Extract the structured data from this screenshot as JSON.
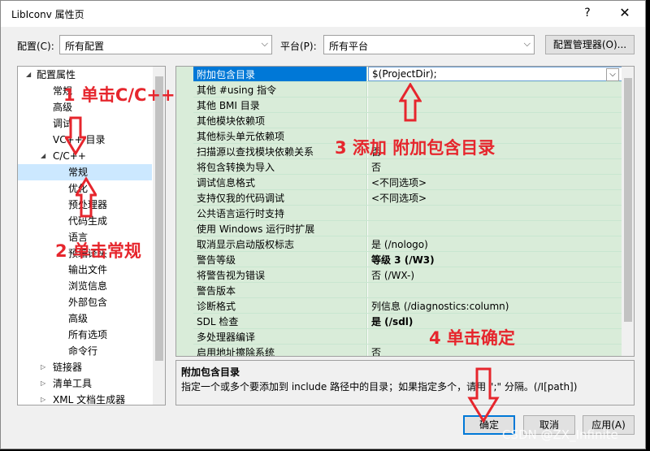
{
  "window": {
    "title": "LibIconv 属性页",
    "help": "?",
    "close": "✕"
  },
  "config": {
    "label": "配置(C):",
    "value": "所有配置"
  },
  "platform": {
    "label": "平台(P):",
    "value": "所有平台"
  },
  "config_manager": "配置管理器(O)...",
  "tree": {
    "items": [
      {
        "label": "配置属性",
        "expander": "◢"
      },
      {
        "label": "常规"
      },
      {
        "label": "高级"
      },
      {
        "label": "调试"
      },
      {
        "label": "VC++ 目录"
      },
      {
        "label": "C/C++",
        "expander": "◢"
      },
      {
        "label": "常规"
      },
      {
        "label": "优化"
      },
      {
        "label": "预处理器"
      },
      {
        "label": "代码生成"
      },
      {
        "label": "语言"
      },
      {
        "label": "预编译头"
      },
      {
        "label": "输出文件"
      },
      {
        "label": "浏览信息"
      },
      {
        "label": "外部包含"
      },
      {
        "label": "高级"
      },
      {
        "label": "所有选项"
      },
      {
        "label": "命令行"
      },
      {
        "label": "链接器",
        "expander": "▷"
      },
      {
        "label": "清单工具",
        "expander": "▷"
      },
      {
        "label": "XML 文档生成器",
        "expander": "▷"
      }
    ]
  },
  "grid": {
    "rows": [
      {
        "key": "附加包含目录",
        "value": "$(ProjectDir);"
      },
      {
        "key": "其他 #using 指令",
        "value": ""
      },
      {
        "key": "其他 BMI 目录",
        "value": ""
      },
      {
        "key": "其他模块依赖项",
        "value": ""
      },
      {
        "key": "其他标头单元依赖项",
        "value": ""
      },
      {
        "key": "扫描源以查找模块依赖关系",
        "value": "否"
      },
      {
        "key": "将包含转换为导入",
        "value": "否"
      },
      {
        "key": "调试信息格式",
        "value": "<不同选项>"
      },
      {
        "key": "支持仅我的代码调试",
        "value": "<不同选项>"
      },
      {
        "key": "公共语言运行时支持",
        "value": ""
      },
      {
        "key": "使用 Windows 运行时扩展",
        "value": ""
      },
      {
        "key": "取消显示启动版权标志",
        "value": "是 (/nologo)"
      },
      {
        "key": "警告等级",
        "value": "等级 3 (/W3)"
      },
      {
        "key": "将警告视为错误",
        "value": "否 (/WX-)"
      },
      {
        "key": "警告版本",
        "value": ""
      },
      {
        "key": "诊断格式",
        "value": "列信息 (/diagnostics:column)"
      },
      {
        "key": "SDL 检查",
        "value": "是 (/sdl)"
      },
      {
        "key": "多处理器编译",
        "value": ""
      },
      {
        "key": "启用地址擦除系统",
        "value": "否"
      }
    ]
  },
  "description": {
    "heading": "附加包含目录",
    "text": "指定一个或多个要添加到 include 路径中的目录；如果指定多个，请用 \";\" 分隔。(/I[path])"
  },
  "buttons": {
    "ok": "确定",
    "cancel": "取消",
    "apply": "应用(A)"
  },
  "annotations": {
    "a1": "1 单击C/C++",
    "a2": "2 单击常规",
    "a3": "3 添加 附加包含目录",
    "a4": "4 单击确定"
  },
  "watermark": "CSDN @ZX_Infinite",
  "colors": {
    "annotation": "#e6262d",
    "grid_bg": "#d9ecd9",
    "selection": "#0078d7"
  }
}
